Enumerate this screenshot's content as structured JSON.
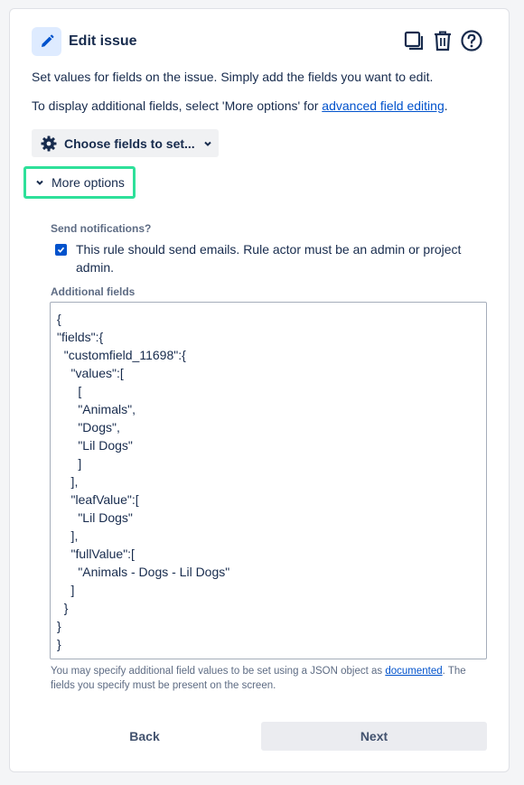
{
  "header": {
    "title": "Edit issue",
    "icons": [
      "pencil-icon",
      "copy-icon",
      "trash-icon",
      "help-icon"
    ],
    "accent": "#0052cc"
  },
  "description": {
    "line1": "Set values for fields on the issue. Simply add the fields you want to edit.",
    "line2_prefix": "To display additional fields, select 'More options' for ",
    "line2_link": "advanced field editing",
    "line2_suffix": "."
  },
  "choose_fields": {
    "label": "Choose fields to set..."
  },
  "more_options": {
    "label": "More options",
    "highlight": "#2ee09a"
  },
  "notifications": {
    "label": "Send notifications?",
    "checkbox_text": "This rule should send emails. Rule actor must be an admin or project admin.",
    "checked": true
  },
  "additional_fields": {
    "label": "Additional fields",
    "value": "{\n\"fields\":{\n  \"customfield_11698\":{\n    \"values\":[\n      [\n      \"Animals\",\n      \"Dogs\",\n      \"Lil Dogs\"\n      ]\n    ],\n    \"leafValue\":[\n      \"Lil Dogs\"\n    ],\n    \"fullValue\":[\n      \"Animals - Dogs - Lil Dogs\"\n    ]\n  }\n}\n}"
  },
  "help": {
    "prefix": "You may specify additional field values to be set using a JSON object as ",
    "link": "documented",
    "suffix": ". The fields you specify must be present on the screen."
  },
  "footer": {
    "back_label": "Back",
    "next_label": "Next"
  }
}
